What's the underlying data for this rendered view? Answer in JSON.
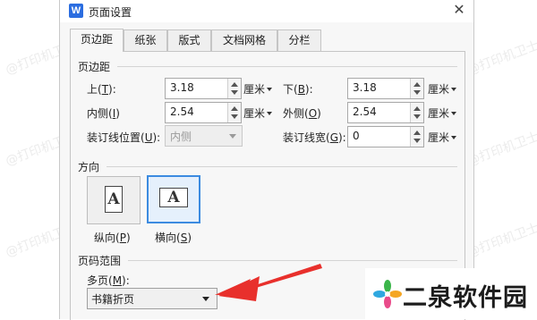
{
  "dialog": {
    "title": "页面设置",
    "app_logo_letter": "W"
  },
  "tabs": [
    {
      "label": "页边距",
      "active": true
    },
    {
      "label": "纸张",
      "active": false
    },
    {
      "label": "版式",
      "active": false
    },
    {
      "label": "文档网格",
      "active": false
    },
    {
      "label": "分栏",
      "active": false
    }
  ],
  "margins": {
    "section_title": "页边距",
    "top": {
      "label_pre": "上(",
      "key": "T",
      "label_post": "):",
      "value": "3.18",
      "unit": "厘米"
    },
    "bottom": {
      "label_pre": "下(",
      "key": "B",
      "label_post": "):",
      "value": "3.18",
      "unit": "厘米"
    },
    "inner": {
      "label_pre": "内侧(",
      "key": "I",
      "label_post": ")",
      "value": "2.54",
      "unit": "厘米"
    },
    "outer": {
      "label_pre": "外侧(",
      "key": "O",
      "label_post": ")",
      "value": "2.54",
      "unit": "厘米"
    },
    "gutter_pos": {
      "label_pre": "装订线位置(",
      "key": "U",
      "label_post": "):",
      "value": "内侧"
    },
    "gutter_width": {
      "label_pre": "装订线宽(",
      "key": "G",
      "label_post": "):",
      "value": "0",
      "unit": "厘米"
    }
  },
  "orientation": {
    "section_title": "方向",
    "portrait": {
      "label_pre": "纵向(",
      "key": "P",
      "label_post": ")",
      "glyph": "A"
    },
    "landscape": {
      "label_pre": "横向(",
      "key": "S",
      "label_post": ")",
      "glyph": "A",
      "selected": true
    }
  },
  "pages": {
    "section_title": "页码范围",
    "multiple_label_pre": "多页(",
    "multiple_key": "M",
    "multiple_label_post": "):",
    "multiple_value": "书籍折页"
  },
  "watermarks": [
    "@打印机卫士",
    "@打印机卫士",
    "@打印机卫士",
    "@打印机卫士",
    "@打印机卫士",
    "@打印机卫士",
    "@打印机卫士",
    "@打印机卫士"
  ],
  "branding": {
    "text": "二泉软件园"
  },
  "colors": {
    "accent": "#3c8be0",
    "arrow": "#e8302c",
    "logo": "#2b6de0"
  }
}
